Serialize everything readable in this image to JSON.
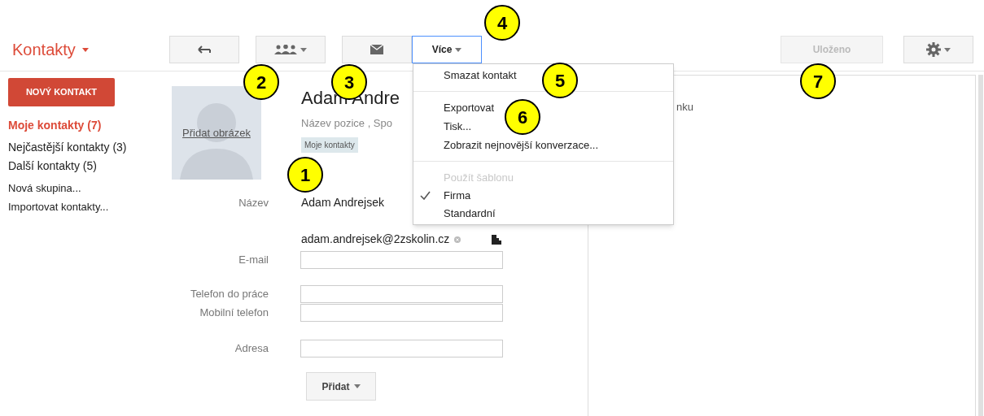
{
  "app_title": "Kontakty",
  "toolbar": {
    "buttons": [
      {
        "kind": "back",
        "selected": false
      },
      {
        "kind": "groups",
        "selected": false
      },
      {
        "kind": "mail",
        "selected": false
      },
      {
        "kind": "more",
        "label": "Více",
        "selected": true
      }
    ],
    "save": {
      "label": "Uloženo",
      "disabled": true
    }
  },
  "sidebar": {
    "new_contact": "NOVÝ KONTAKT",
    "groups": [
      {
        "label": "Moje kontakty (7)",
        "selected": true
      },
      {
        "label": "Nejčastější kontakty (3)",
        "selected": false
      },
      {
        "label": "Další kontakty (5)",
        "selected": false
      }
    ],
    "actions": [
      "Nová skupina...",
      "Importovat kontakty..."
    ]
  },
  "contact": {
    "add_photo": "Přidat obrázek",
    "name": "Adam Andre",
    "subtitle": "Název pozice , Spo",
    "tag": "Moje kontakty",
    "fields": [
      {
        "kind": "static",
        "label": "Název",
        "value": "Adam Andrejsek"
      },
      {
        "kind": "email",
        "label": "E-mail",
        "value": "adam.andrejsek@2zskolin.cz"
      },
      {
        "kind": "input",
        "label": "Telefon do práce"
      },
      {
        "kind": "input",
        "label": "Mobilní telefon"
      },
      {
        "kind": "input",
        "label": "Adresa"
      }
    ],
    "add_button": "Přidat"
  },
  "right_panel": {
    "text": "nku"
  },
  "menu": [
    {
      "kind": "item",
      "label": "Smazat kontakt"
    },
    {
      "kind": "divider"
    },
    {
      "kind": "item",
      "label": "Exportovat"
    },
    {
      "kind": "item",
      "label": "Tisk..."
    },
    {
      "kind": "item",
      "label": "Zobrazit nejnovější konverzace..."
    },
    {
      "kind": "divider"
    },
    {
      "kind": "header",
      "label": "Použít šablonu"
    },
    {
      "kind": "option",
      "label": "Firma",
      "checked": true
    },
    {
      "kind": "option",
      "label": "Standardní",
      "checked": false
    }
  ],
  "callouts": [
    "1",
    "2",
    "3",
    "4",
    "5",
    "6",
    "7"
  ]
}
